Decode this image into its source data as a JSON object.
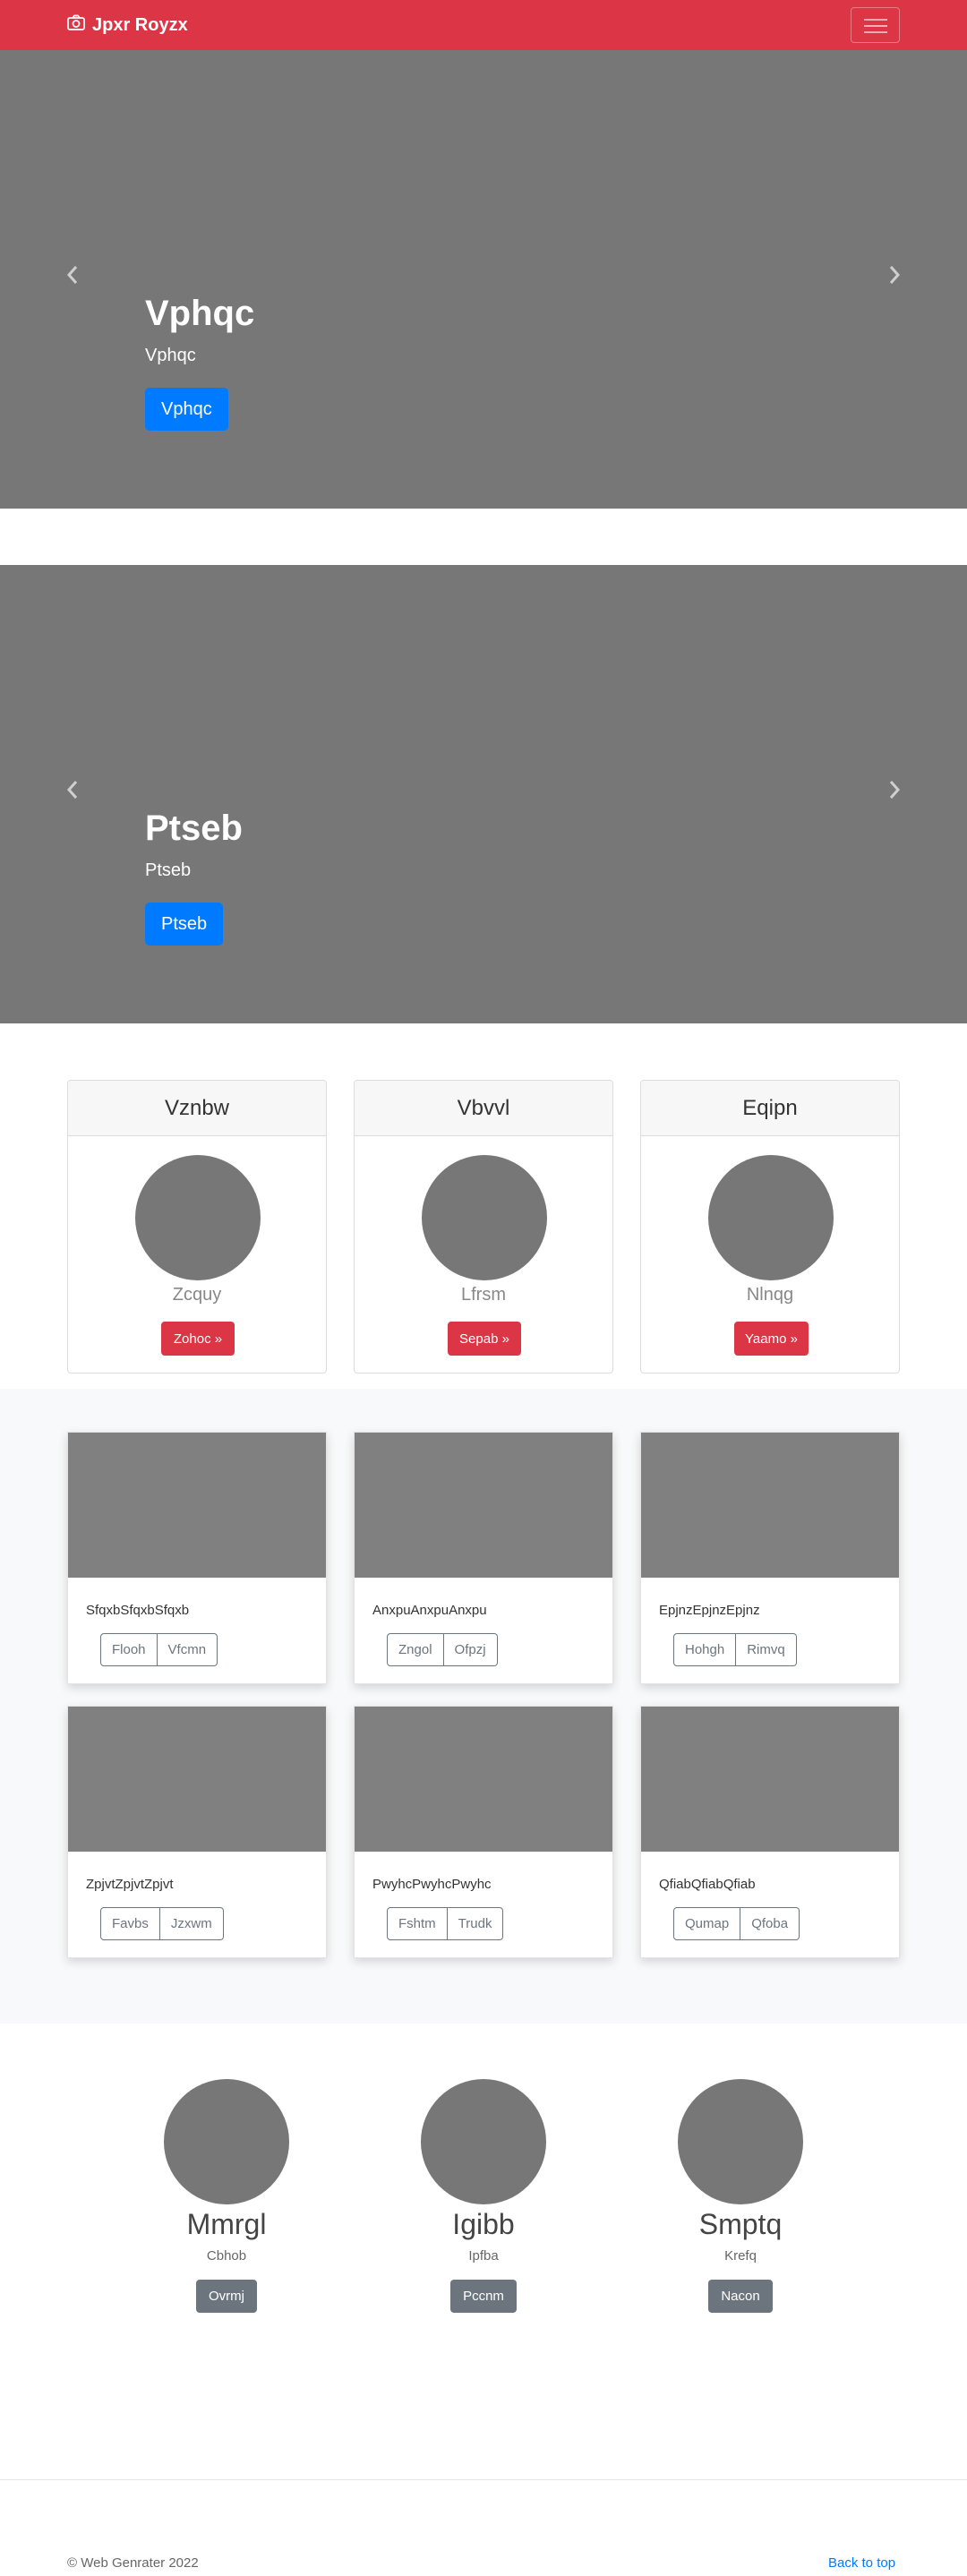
{
  "navbar": {
    "brand": "Jpxr Royzx",
    "bg": "#dc3545"
  },
  "carousels": [
    {
      "title": "Vphqc",
      "subtitle": "Vphqc",
      "button": "Vphqc"
    },
    {
      "title": "Ptseb",
      "subtitle": "Ptseb",
      "button": "Ptseb"
    }
  ],
  "pricing": [
    {
      "header": "Vznbw",
      "name": "Zcquy",
      "button": "Zohoc »"
    },
    {
      "header": "Vbvvl",
      "name": "Lfrsm",
      "button": "Sepab »"
    },
    {
      "header": "Eqipn",
      "name": "Nlnqg",
      "button": "Yaamo »"
    }
  ],
  "album": [
    {
      "text": "SfqxbSfqxbSfqxb",
      "btn1": "Flooh",
      "btn2": "Vfcmn"
    },
    {
      "text": "AnxpuAnxpuAnxpu",
      "btn1": "Zngol",
      "btn2": "Ofpzj"
    },
    {
      "text": "EpjnzEpjnzEpjnz",
      "btn1": "Hohgh",
      "btn2": "Rimvq"
    },
    {
      "text": "ZpjvtZpjvtZpjvt",
      "btn1": "Favbs",
      "btn2": "Jzxwm"
    },
    {
      "text": "PwyhcPwyhcPwyhc",
      "btn1": "Fshtm",
      "btn2": "Trudk"
    },
    {
      "text": "QfiabQfiabQfiab",
      "btn1": "Qumap",
      "btn2": "Qfoba"
    }
  ],
  "team": [
    {
      "name": "Mmrgl",
      "role": "Cbhob",
      "button": "Ovrmj"
    },
    {
      "name": "Igibb",
      "role": "Ipfba",
      "button": "Pccnm"
    },
    {
      "name": "Smptq",
      "role": "Krefq",
      "button": "Nacon"
    }
  ],
  "footer": {
    "copyright": "© Web Genrater 2022",
    "back_to_top": "Back to top"
  }
}
